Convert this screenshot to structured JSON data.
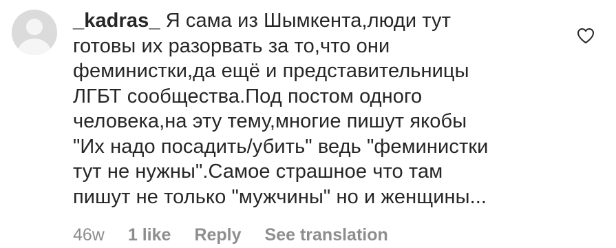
{
  "comment": {
    "username": "_kadras_",
    "text_lines": [
      " Я сама из Шымкента,люди тут",
      "готовы их разорвать за то,что они",
      "феминистки,да ещё и представительницы",
      "ЛГБТ сообщества.Под постом одного",
      "человека,на эту тему,многие пишут якобы",
      "\"Их надо посадить/убить\" ведь \"феминистки",
      "тут не нужны\".Самое страшное что там",
      "пишут не только \"мужчины\" но и женщины..."
    ],
    "meta": {
      "age": "46w",
      "likes": "1 like",
      "reply": "Reply",
      "translation": "See translation"
    },
    "icons": {
      "avatar": "default-avatar-icon",
      "like": "heart-outline-icon"
    }
  }
}
